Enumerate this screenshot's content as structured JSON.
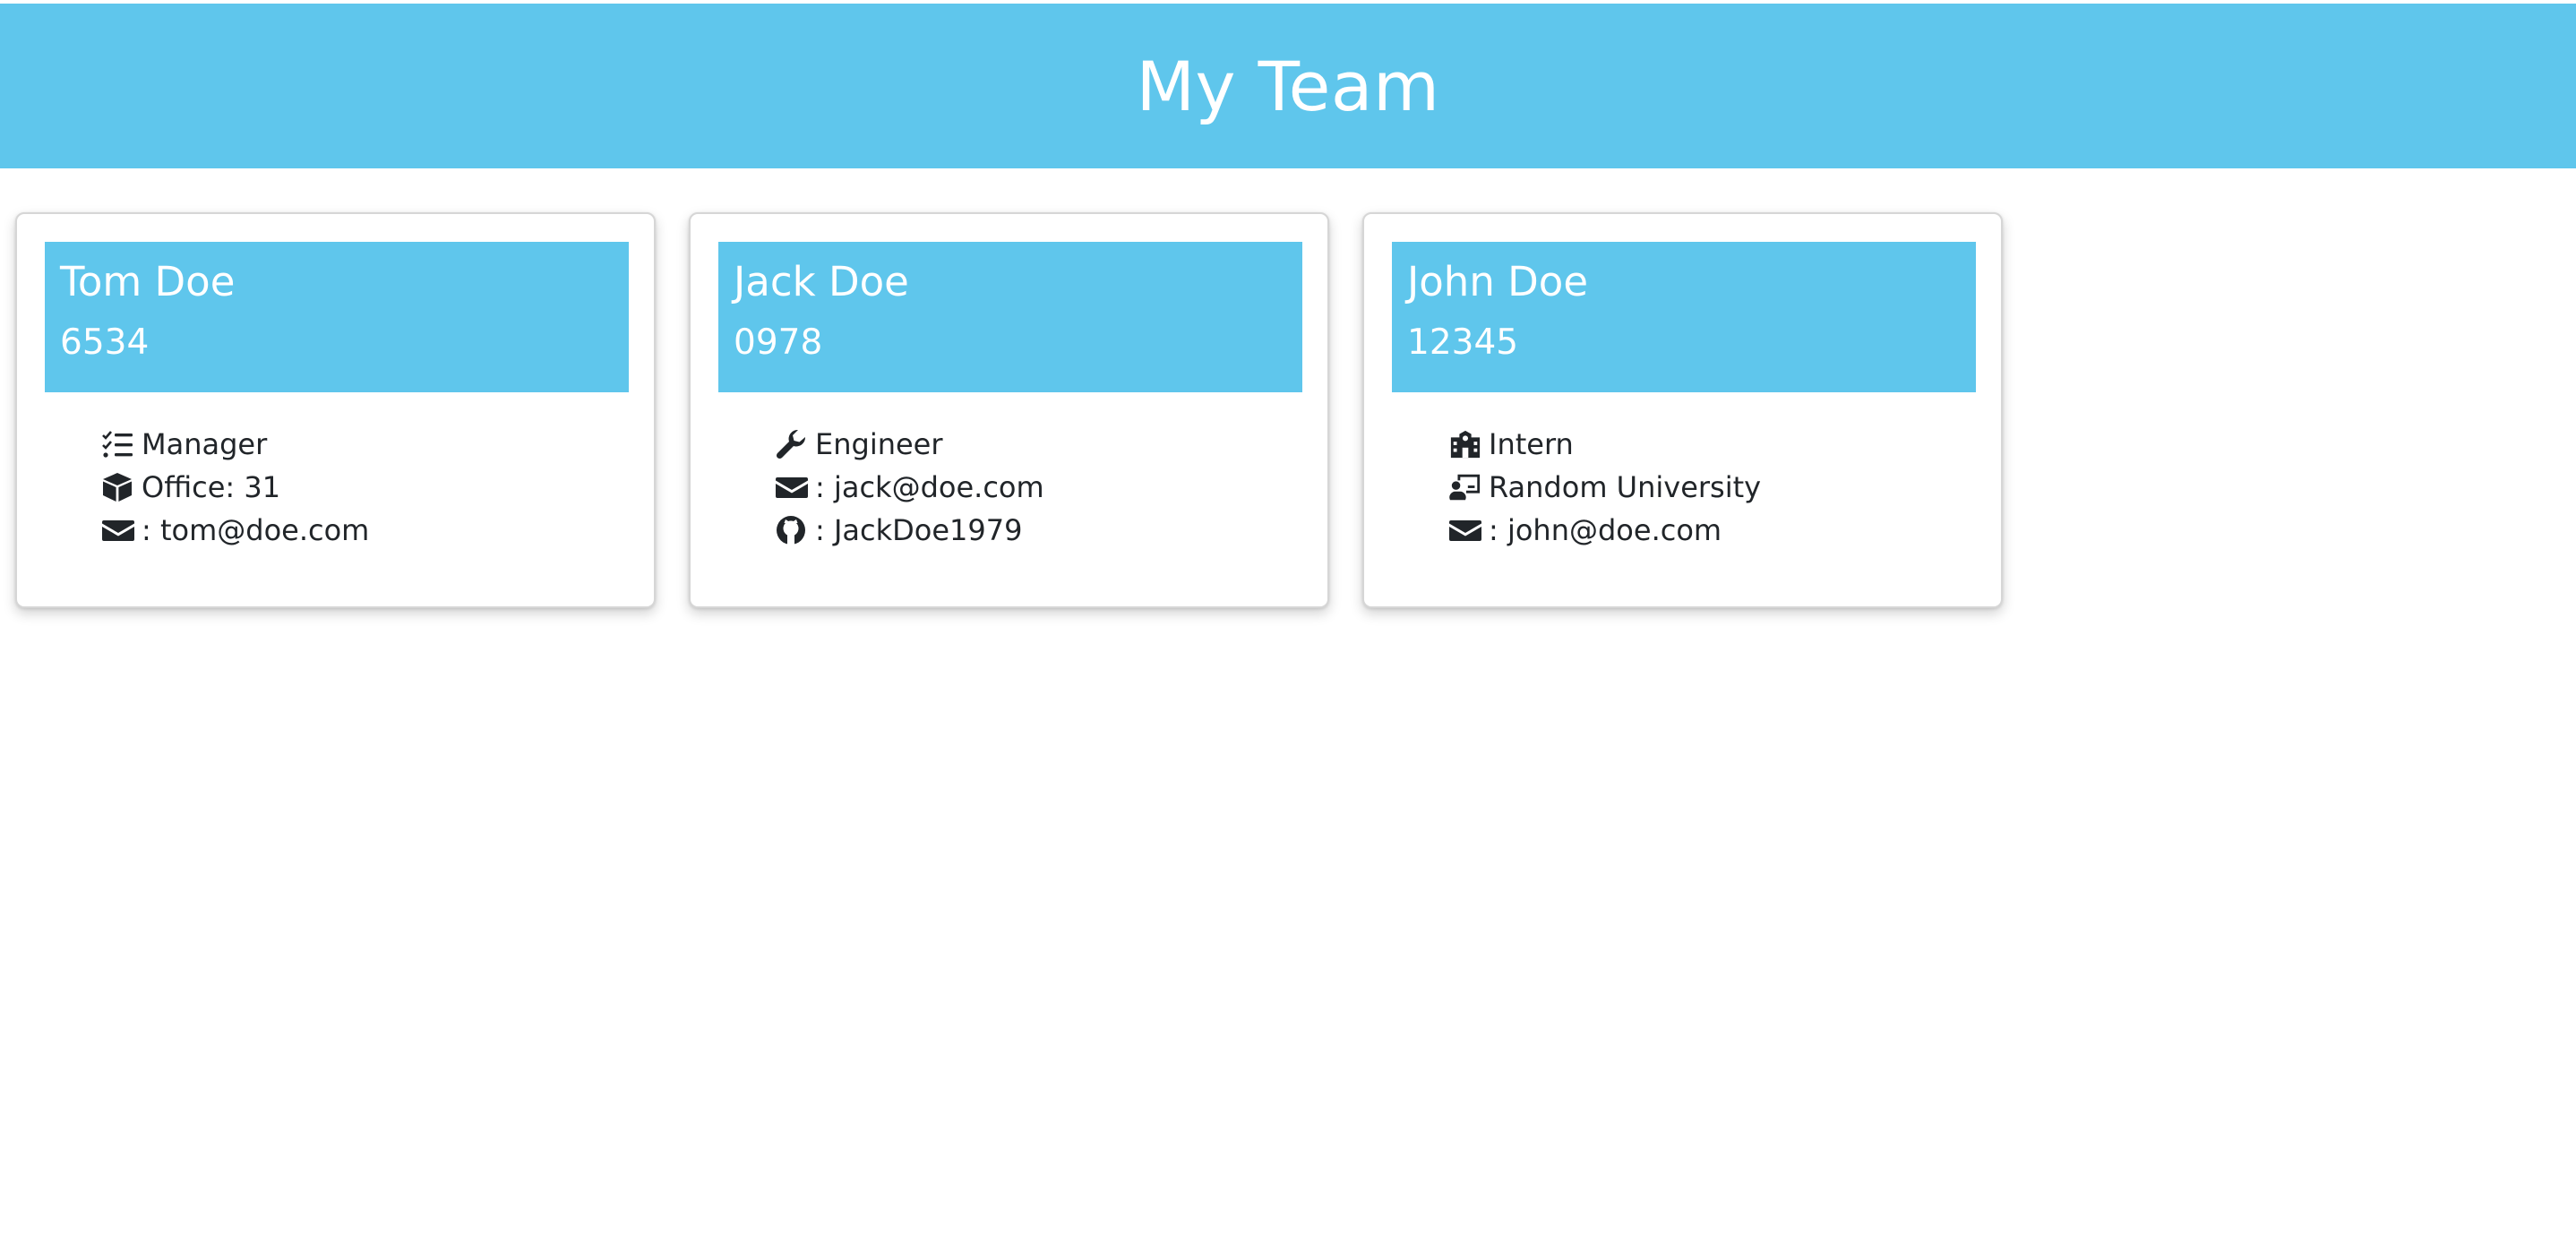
{
  "header": {
    "title": "My Team"
  },
  "cards": [
    {
      "name": "Tom Doe",
      "id": "6534",
      "role_icon": "list-check-icon",
      "role": "Manager",
      "detail_icon": "box-icon",
      "detail": "Office: 31",
      "email_icon": "envelope-icon",
      "email": ": tom@doe.com"
    },
    {
      "name": "Jack Doe",
      "id": "0978",
      "role_icon": "wrench-icon",
      "role": "Engineer",
      "email_icon": "envelope-icon",
      "email": ": jack@doe.com",
      "detail_icon": "github-icon",
      "detail": ": JackDoe1979"
    },
    {
      "name": "John Doe",
      "id": "12345",
      "role_icon": "school-icon",
      "role": "Intern",
      "detail_icon": "chalkboard-user-icon",
      "detail": "Random University",
      "email_icon": "envelope-icon",
      "email": ": john@doe.com"
    }
  ],
  "colors": {
    "accent": "#5fc6ec",
    "text": "#212529",
    "on_accent": "#ffffff"
  }
}
